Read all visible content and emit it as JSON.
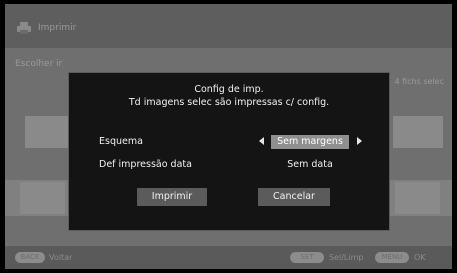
{
  "background": {
    "title": "Imprimir",
    "subtitle": "Escolher ir",
    "count": "4 fichs selec",
    "hints": [
      {
        "key": "BACK",
        "label": "Voltar"
      },
      {
        "key": "SET",
        "label": "Sel/Limp"
      },
      {
        "key": "MENU",
        "label": "OK"
      }
    ]
  },
  "dialog": {
    "title": "Config de imp.",
    "message": "Td imagens selec são impressas c/ config.",
    "scheme_label": "Esquema",
    "scheme_value": "Sem margens",
    "date_label": "Def impressão data",
    "date_value": "Sem data",
    "print_button": "Imprimir",
    "cancel_button": "Cancelar"
  },
  "colors": {
    "dialog_bg": "#141414",
    "selected_bg": "#8f8f8f",
    "button_bg": "#5b5b5b"
  }
}
